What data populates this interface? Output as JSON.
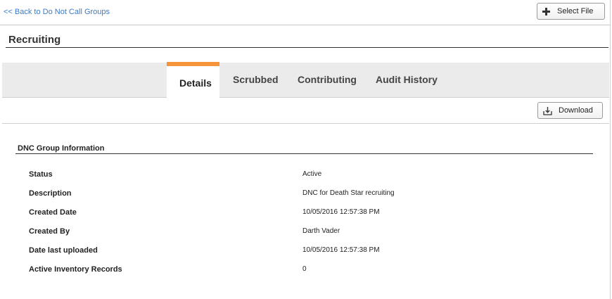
{
  "nav": {
    "back_label": "<< Back to Do Not Call Groups",
    "select_file_label": "Select File",
    "select_file_icon": "plus-icon"
  },
  "page": {
    "title": "Recruiting"
  },
  "tabs": [
    {
      "label": "Details",
      "active": true
    },
    {
      "label": "Scrubbed",
      "active": false
    },
    {
      "label": "Contributing",
      "active": false
    },
    {
      "label": "Audit History",
      "active": false
    }
  ],
  "tab_accent_color": "#f5943a",
  "link_color": "#3a7bc8",
  "toolbar": {
    "download_label": "Download",
    "download_icon": "download-icon"
  },
  "info": {
    "title": "DNC Group Information",
    "rows": [
      {
        "label": "Status",
        "value": "Active"
      },
      {
        "label": "Description",
        "value": "DNC for Death Star recruiting"
      },
      {
        "label": "Created Date",
        "value": "10/05/2016 12:57:38 PM"
      },
      {
        "label": "Created By",
        "value": "Darth Vader"
      },
      {
        "label": "Date last uploaded",
        "value": "10/05/2016 12:57:38 PM"
      },
      {
        "label": "Active Inventory Records",
        "value": "0"
      }
    ]
  }
}
